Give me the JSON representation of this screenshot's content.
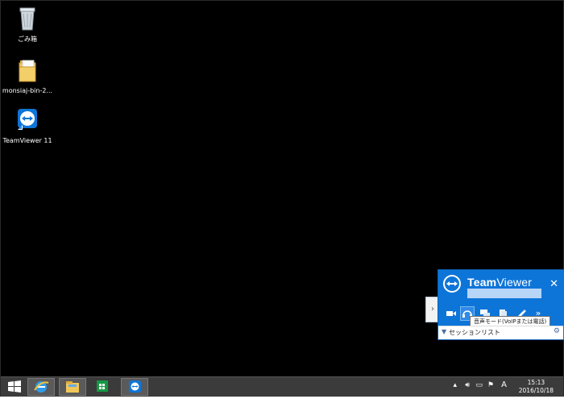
{
  "desktop": {
    "icons": [
      {
        "label": "ごみ箱",
        "icon": "recycle-bin-icon"
      },
      {
        "label": "monsiaj-bin-2...",
        "icon": "folder-icon"
      },
      {
        "label": "TeamViewer 11",
        "icon": "teamviewer-icon"
      }
    ]
  },
  "teamviewer": {
    "brand_bold": "Team",
    "brand_regular": "Viewer",
    "close_label": "✕",
    "toolbar": [
      {
        "icon": "camera-icon"
      },
      {
        "icon": "headset-icon"
      },
      {
        "icon": "chat-icon"
      },
      {
        "icon": "files-icon"
      },
      {
        "icon": "whiteboard-icon"
      },
      {
        "icon": "more-icon",
        "label": "»"
      }
    ],
    "tooltip": "音声モード(VoIPまたは電話)",
    "session_list": "セッションリスト"
  },
  "taskbar": {
    "apps": [
      {
        "icon": "windows-start-icon"
      },
      {
        "icon": "internet-explorer-icon"
      },
      {
        "icon": "file-explorer-icon"
      },
      {
        "icon": "store-icon"
      },
      {
        "icon": "teamviewer-taskbar-icon"
      }
    ],
    "ime": "A",
    "time": "15:13",
    "date": "2016/10/18"
  },
  "colors": {
    "desktop_bg": "#000000",
    "taskbar_bg": "#3b3b3b",
    "tv_blue": "#0e75d8"
  }
}
